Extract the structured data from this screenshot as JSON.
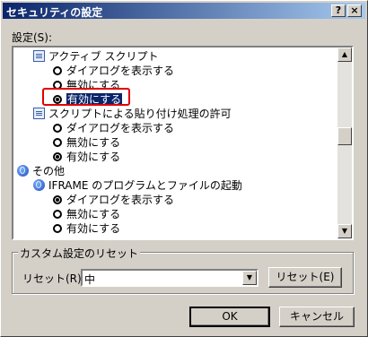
{
  "window": {
    "title": "セキュリティの設定",
    "help_glyph": "?",
    "close_glyph": "×"
  },
  "settings": {
    "label": "設定(S):",
    "items": [
      {
        "type": "category",
        "icon": "document-icon",
        "label": "アクティブ スクリプト"
      },
      {
        "type": "option",
        "label": "ダイアログを表示する",
        "checked": false
      },
      {
        "type": "option",
        "label": "無効にする",
        "checked": false
      },
      {
        "type": "option",
        "label": "有効にする",
        "checked": true,
        "selected": true
      },
      {
        "type": "category",
        "icon": "document-icon",
        "label": "スクリプトによる貼り付け処理の許可"
      },
      {
        "type": "option",
        "label": "ダイアログを表示する",
        "checked": false
      },
      {
        "type": "option",
        "label": "無効にする",
        "checked": false
      },
      {
        "type": "option",
        "label": "有効にする",
        "checked": true
      },
      {
        "type": "group",
        "icon": "globe-icon",
        "label": "その他"
      },
      {
        "type": "category",
        "icon": "globe-icon",
        "label": "IFRAME のプログラムとファイルの起動"
      },
      {
        "type": "option",
        "label": "ダイアログを表示する",
        "checked": true
      },
      {
        "type": "option",
        "label": "無効にする",
        "checked": false
      },
      {
        "type": "option",
        "label": "有効にする",
        "checked": false
      }
    ]
  },
  "custom_reset": {
    "group_title": "カスタム設定のリセット",
    "reset_label": "リセット(R):",
    "reset_value": "中",
    "reset_button": "リセット(E)"
  },
  "buttons": {
    "ok": "OK",
    "cancel": "キャンセル"
  }
}
